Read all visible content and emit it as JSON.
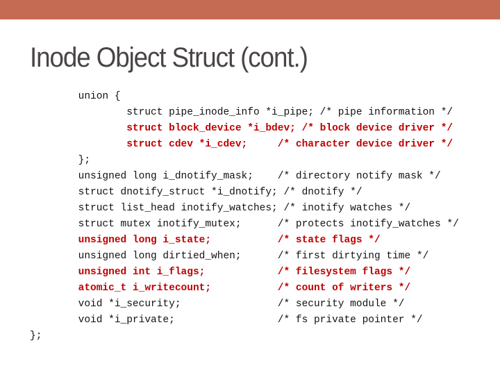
{
  "slide": {
    "accent_bar_color": "#C56B53",
    "title": "Inode Object Struct (cont.)",
    "highlight_color": "#C00000",
    "code_lines": [
      {
        "text": "        union {",
        "highlight": false
      },
      {
        "text": "                struct pipe_inode_info *i_pipe; /* pipe information */",
        "highlight": false
      },
      {
        "text": "                struct block_device *i_bdev; /* block device driver */",
        "highlight": true
      },
      {
        "text": "                struct cdev *i_cdev;     /* character device driver */",
        "highlight": true
      },
      {
        "text": "        };",
        "highlight": false
      },
      {
        "text": "        unsigned long i_dnotify_mask;    /* directory notify mask */",
        "highlight": false
      },
      {
        "text": "        struct dnotify_struct *i_dnotify; /* dnotify */",
        "highlight": false
      },
      {
        "text": "        struct list_head inotify_watches; /* inotify watches */",
        "highlight": false
      },
      {
        "text": "        struct mutex inotify_mutex;      /* protects inotify_watches */",
        "highlight": false
      },
      {
        "text": "        unsigned long i_state;           /* state flags */",
        "highlight": true
      },
      {
        "text": "        unsigned long dirtied_when;      /* first dirtying time */",
        "highlight": false
      },
      {
        "text": "        unsigned int i_flags;            /* filesystem flags */",
        "highlight": true
      },
      {
        "text": "        atomic_t i_writecount;           /* count of writers */",
        "highlight": true
      },
      {
        "text": "        void *i_security;                /* security module */",
        "highlight": false
      },
      {
        "text": "        void *i_private;                 /* fs private pointer */",
        "highlight": false
      },
      {
        "text": "};",
        "highlight": false
      }
    ]
  }
}
